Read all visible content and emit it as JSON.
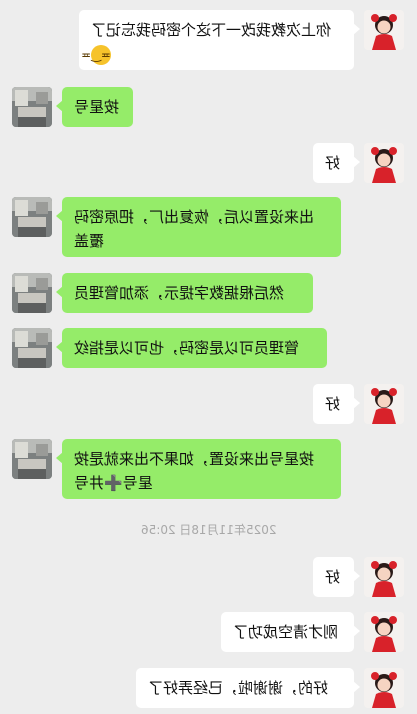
{
  "messages": [
    {
      "side": "right",
      "lines": [
        "你上次教我改一下这个密码我忘记了",
        "😁"
      ]
    },
    {
      "side": "left",
      "text": "按星号"
    },
    {
      "side": "right",
      "text": "好"
    },
    {
      "side": "left",
      "lines": [
        "出来设置以后，恢复出厂，把原密码",
        "覆盖"
      ]
    },
    {
      "side": "left",
      "text": "然后根据数字提示，添加管理员"
    },
    {
      "side": "left",
      "text": "管理员可以是密码，也可以是指纹"
    },
    {
      "side": "right",
      "text": "好"
    },
    {
      "side": "left",
      "lines": [
        "按星号出来设置，如果不出来就是按",
        "星号➕井号"
      ]
    },
    {
      "side": "right",
      "text": "好"
    },
    {
      "side": "right",
      "text": "刚才清空成功了"
    },
    {
      "side": "right",
      "text": "好的，谢谢啦，已经弄好了"
    }
  ],
  "timestamp": "2025年11月18日 20:56",
  "colors": {
    "background": "#ededed",
    "incoming": "#95ec69",
    "outgoing": "#ffffff"
  },
  "icons": {
    "avatar_self": "girl-avatar",
    "avatar_other": "room-photo-avatar",
    "emoji": "grinning-face"
  }
}
